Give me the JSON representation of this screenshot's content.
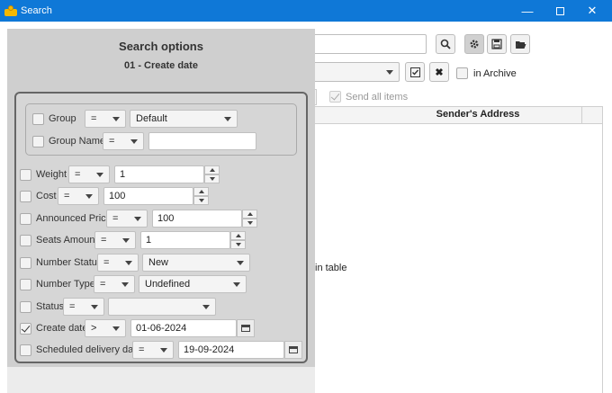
{
  "window": {
    "title": "Search",
    "minimize": "—",
    "close": "✕"
  },
  "background": {
    "in_archive": "in Archive",
    "send_all_items": "Send all items",
    "senders_address": "Sender's Address",
    "no_content_text": "in table",
    "icons": [
      "search-icon",
      "gear-icon",
      "save-icon",
      "folder-open-icon",
      "check-icon",
      "clear-icon"
    ]
  },
  "panel": {
    "title": "Search options",
    "subtitle": "01 - Create date",
    "group": {
      "label": "Group",
      "op": "=",
      "value": "Default"
    },
    "group_name": {
      "label": "Group Name",
      "op": "=",
      "value": ""
    },
    "weight": {
      "label": "Weight",
      "op": "=",
      "value": "1"
    },
    "cost": {
      "label": "Cost",
      "op": "=",
      "value": "100"
    },
    "announced_price": {
      "label": "Announced Price",
      "op": "=",
      "value": "100"
    },
    "seats_amount": {
      "label": "Seats Amount",
      "op": "=",
      "value": "1"
    },
    "number_status": {
      "label": "Number Status",
      "op": "=",
      "value": "New"
    },
    "number_type": {
      "label": "Number Type",
      "op": "=",
      "value": "Undefined"
    },
    "status": {
      "label": "Status",
      "op": "=",
      "value": ""
    },
    "create_date": {
      "label": "Create date",
      "op": ">",
      "value": "01-06-2024",
      "checked": true
    },
    "scheduled_delivery": {
      "label": "Scheduled delivery date",
      "op": "=",
      "value": "19-09-2024"
    }
  }
}
